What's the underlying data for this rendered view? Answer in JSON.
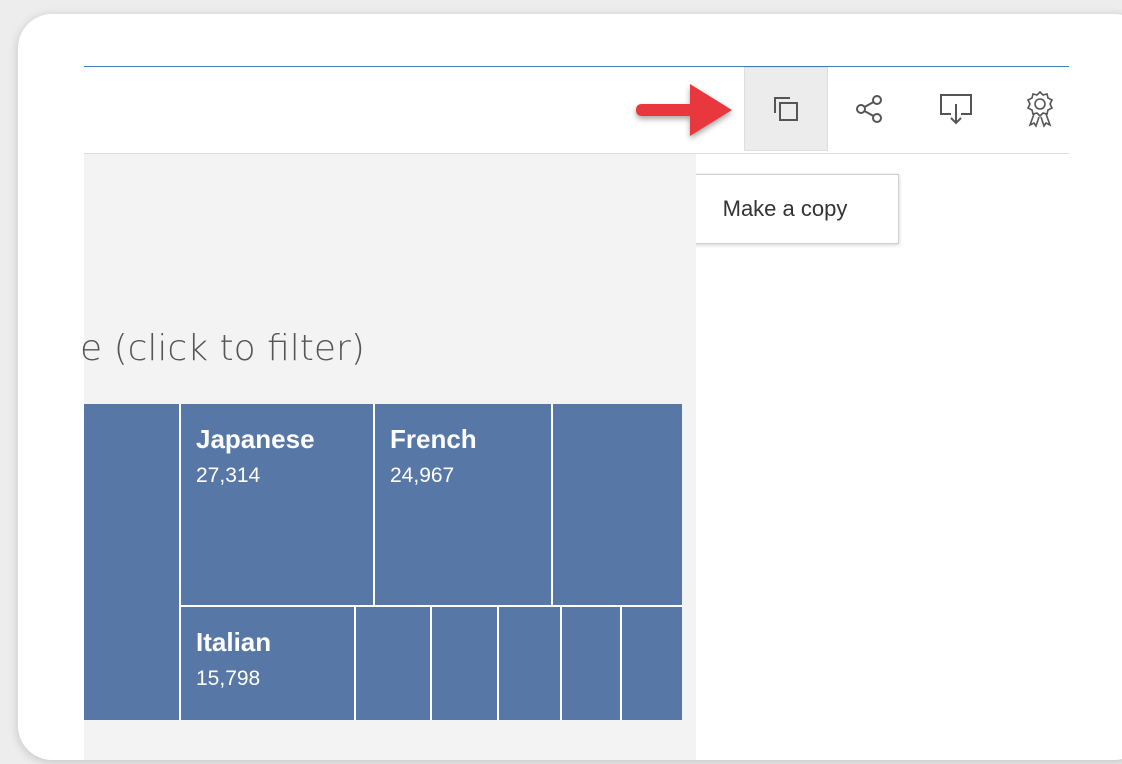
{
  "toolbar": {
    "buttons": [
      {
        "name": "make-copy",
        "icon": "copy-icon",
        "active": true
      },
      {
        "name": "share",
        "icon": "share-icon",
        "active": false
      },
      {
        "name": "download",
        "icon": "download-icon",
        "active": false
      },
      {
        "name": "metrics",
        "icon": "award-icon",
        "active": false
      }
    ]
  },
  "tooltip": {
    "label": "Make a copy"
  },
  "annotation": {
    "arrow_color": "#e8383d",
    "icon": "red-arrow-icon"
  },
  "section": {
    "title": "e (click to filter)"
  },
  "treemap": {
    "color": "#5778a6",
    "tiles": [
      {
        "name": "",
        "value": ""
      },
      {
        "name": "Japanese",
        "value": "27,314"
      },
      {
        "name": "French",
        "value": "24,967"
      },
      {
        "name": "",
        "value": ""
      },
      {
        "name": "Italian",
        "value": "15,798"
      },
      {
        "name": "",
        "value": ""
      },
      {
        "name": "",
        "value": ""
      },
      {
        "name": "",
        "value": ""
      },
      {
        "name": "",
        "value": ""
      },
      {
        "name": "",
        "value": ""
      }
    ]
  }
}
